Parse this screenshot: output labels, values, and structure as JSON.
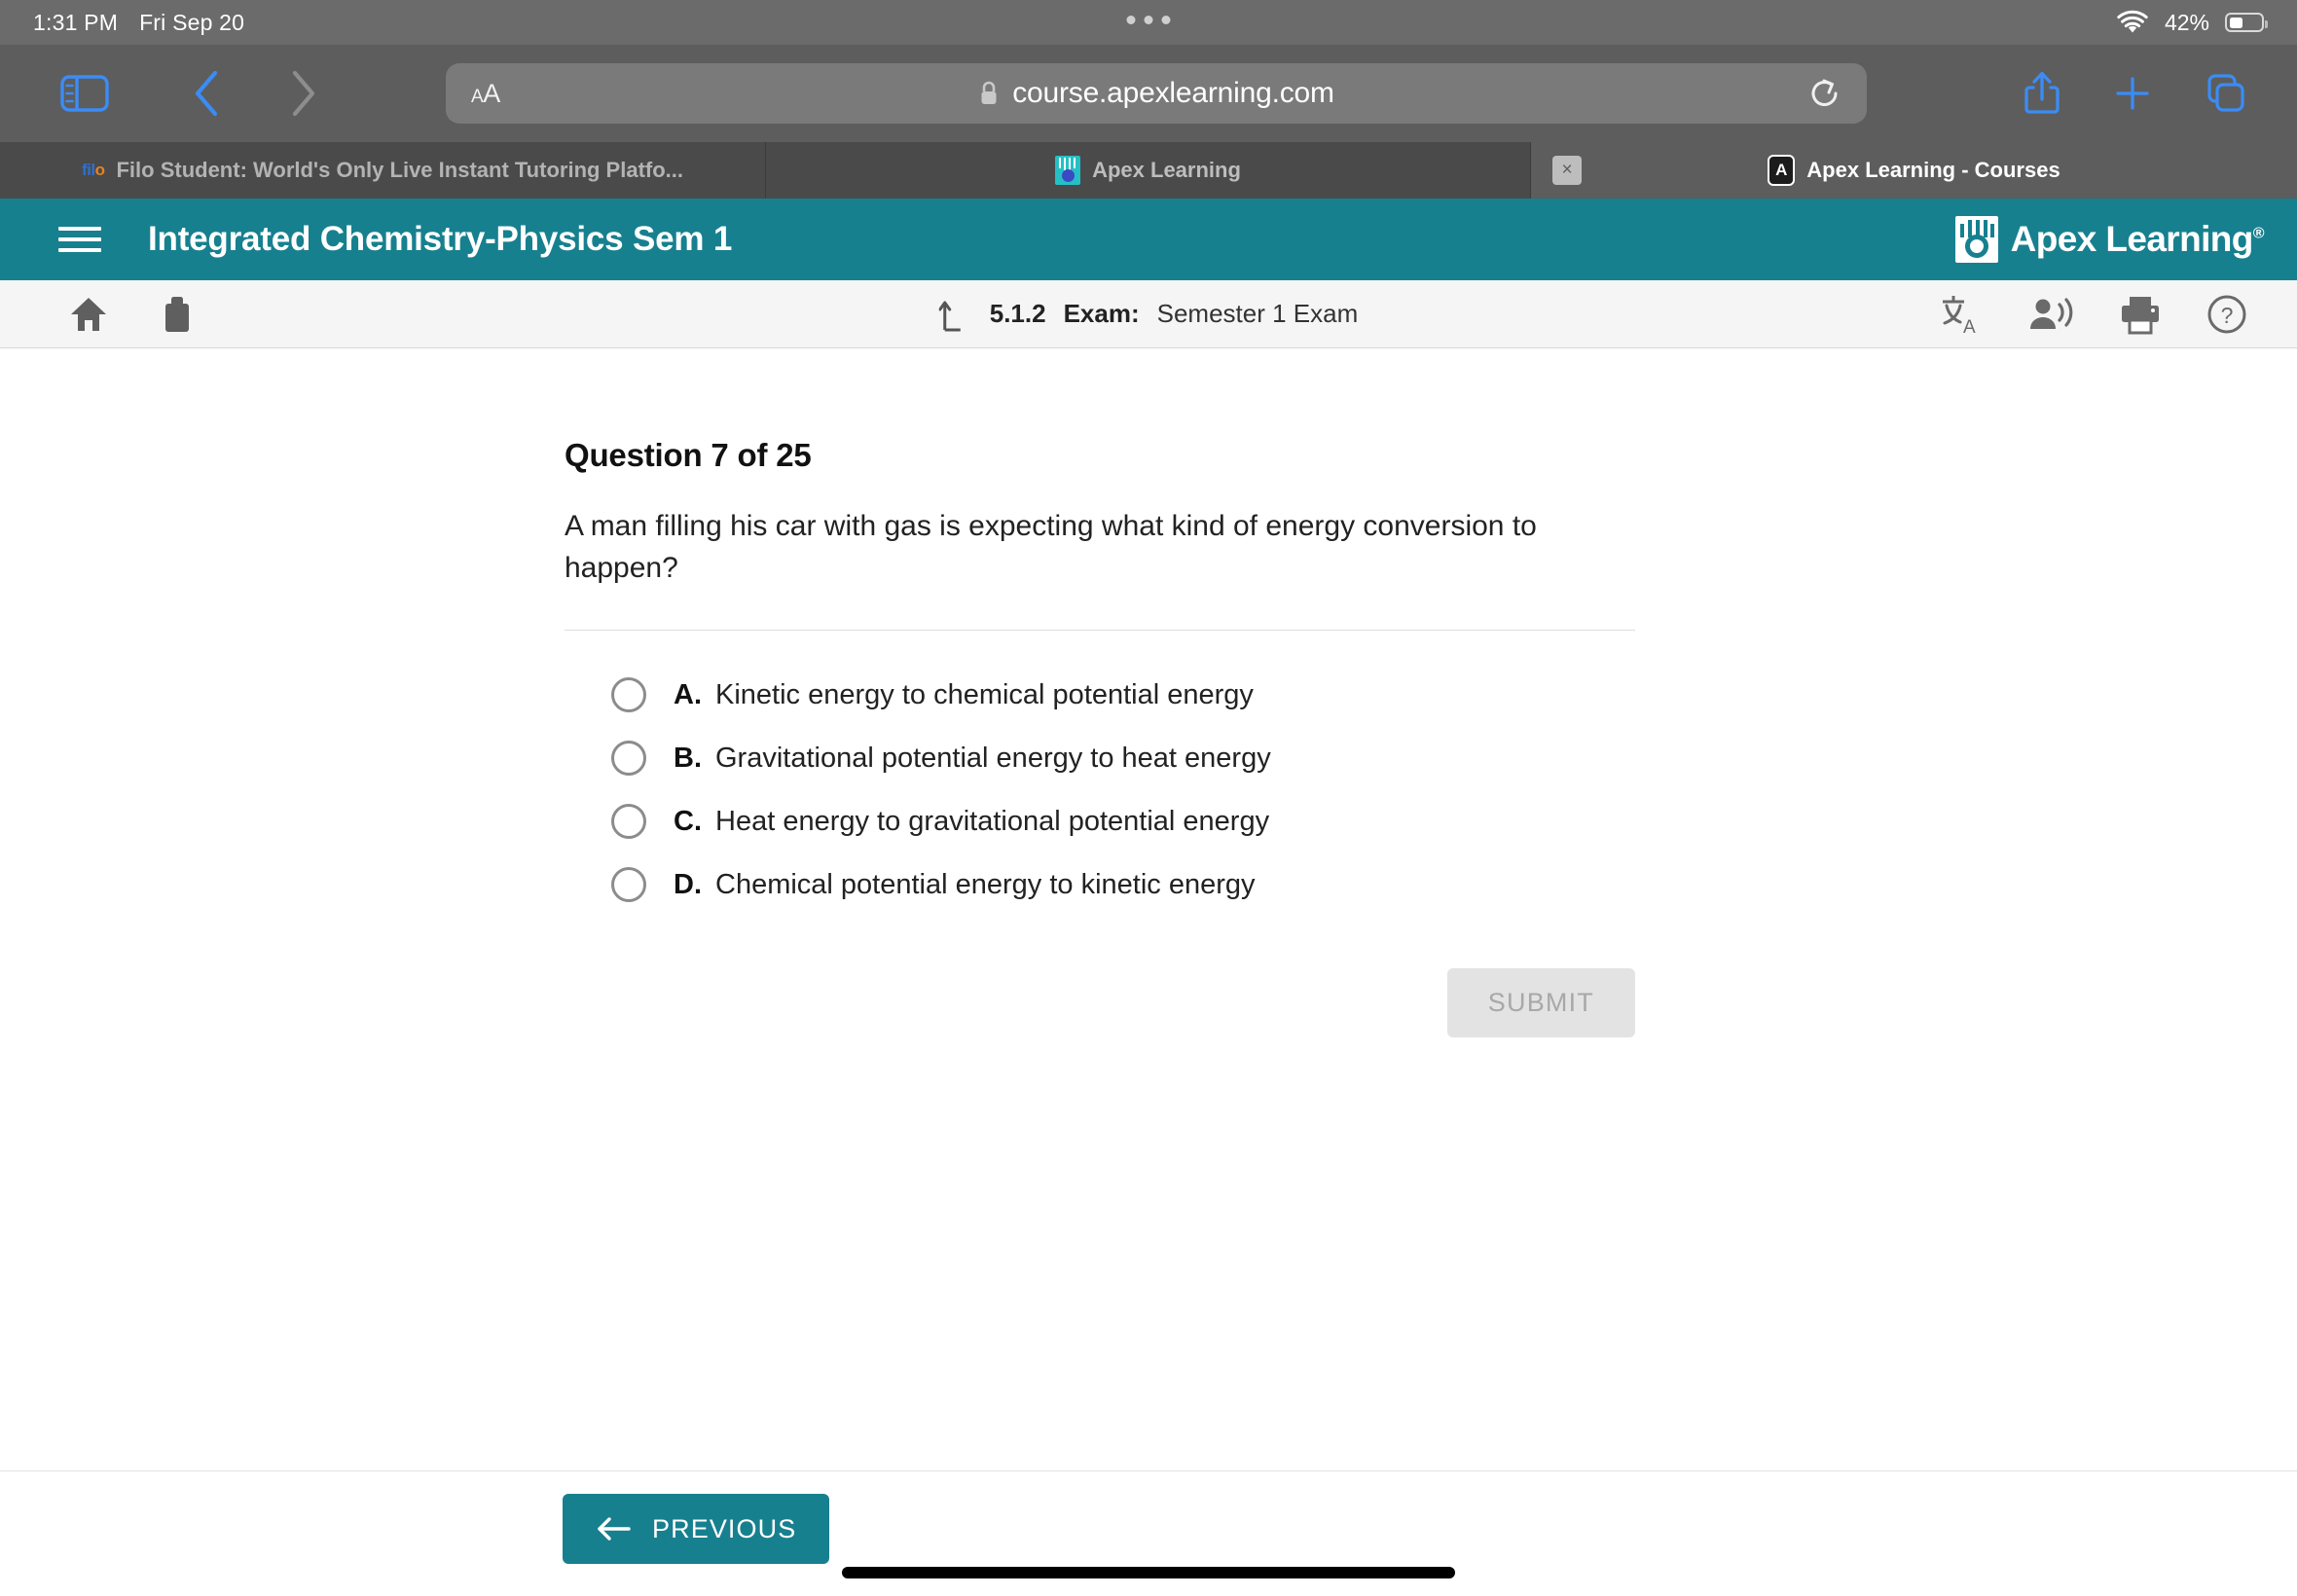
{
  "statusbar": {
    "time": "1:31 PM",
    "date": "Fri Sep 20",
    "battery_percent": "42%",
    "wifi_icon": "wifi-icon",
    "battery_icon": "battery-icon"
  },
  "browser": {
    "sidebar_icon": "sidebar-toggle-icon",
    "back_icon": "back-chevron-icon",
    "forward_icon": "forward-chevron-icon",
    "text_size_label": "AA",
    "lock_icon": "lock-icon",
    "url": "course.apexlearning.com",
    "reload_icon": "reload-icon",
    "share_icon": "share-icon",
    "new_tab_icon": "plus-icon",
    "tabs_overview_icon": "tabs-overview-icon",
    "tabs": [
      {
        "title": "Filo Student: World's Only Live Instant Tutoring Platfo...",
        "favicon": "filo-favicon",
        "active": false
      },
      {
        "title": "Apex Learning",
        "favicon": "apex-favicon",
        "active": false
      },
      {
        "title": "Apex Learning - Courses",
        "favicon": "apex-courses-favicon",
        "active": true,
        "close_label": "×"
      }
    ]
  },
  "app_header": {
    "menu_icon": "hamburger-menu-icon",
    "course_title": "Integrated Chemistry-Physics Sem 1",
    "logo_text": "Apex Learning",
    "logo_reg": "®",
    "accent_color": "#17808f"
  },
  "subbar": {
    "home_icon": "home-icon",
    "briefcase_icon": "briefcase-icon",
    "up_arrow_icon": "up-level-arrow-icon",
    "activity_number": "5.1.2",
    "activity_kind": "Exam:",
    "activity_name": "Semester 1 Exam",
    "translate_icon": "translate-icon",
    "read_aloud_icon": "read-aloud-icon",
    "print_icon": "print-icon",
    "help_icon": "help-icon"
  },
  "question": {
    "heading": "Question 7 of 25",
    "number": 7,
    "total": 25,
    "prompt": "A man filling his car with gas is expecting what kind of energy conversion to happen?",
    "choices": [
      {
        "letter": "A.",
        "text": "Kinetic energy to chemical potential energy",
        "selected": false
      },
      {
        "letter": "B.",
        "text": "Gravitational potential energy to heat energy",
        "selected": false
      },
      {
        "letter": "C.",
        "text": "Heat energy to gravitational potential energy",
        "selected": false
      },
      {
        "letter": "D.",
        "text": "Chemical potential energy to kinetic energy",
        "selected": false
      }
    ],
    "submit_label": "SUBMIT",
    "submit_enabled": false
  },
  "footer": {
    "previous_label": "PREVIOUS",
    "previous_icon": "left-arrow-icon"
  }
}
